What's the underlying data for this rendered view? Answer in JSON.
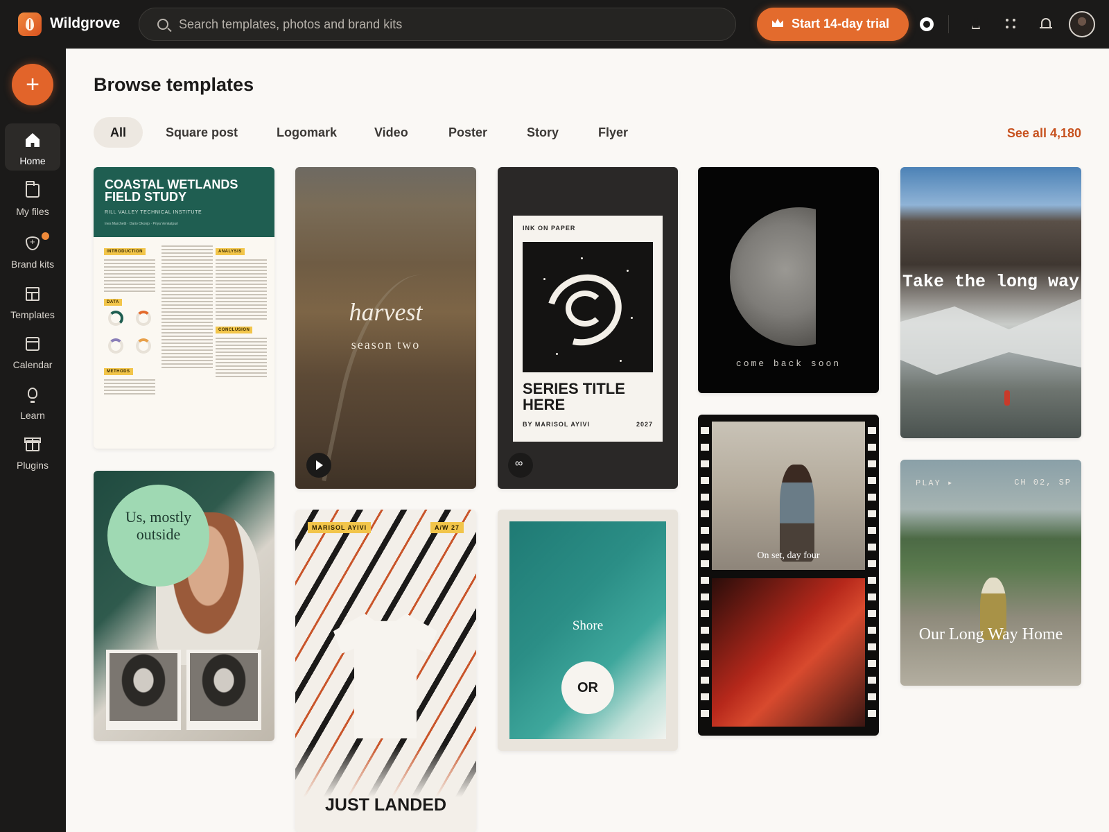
{
  "app": {
    "name": "Wildgrove",
    "search_placeholder": "Search templates, photos and brand kits",
    "trial_label": "Start 14-day trial"
  },
  "sidebar": {
    "create_label": "+",
    "items": [
      {
        "label": "Home",
        "icon": "home-icon",
        "active": true
      },
      {
        "label": "My files",
        "icon": "folder-icon"
      },
      {
        "label": "Brand kits",
        "icon": "shield-icon"
      },
      {
        "label": "Templates",
        "icon": "templates-icon"
      },
      {
        "label": "Calendar",
        "icon": "calendar-icon"
      },
      {
        "label": "Learn",
        "icon": "lightbulb-icon"
      },
      {
        "label": "Plugins",
        "icon": "gift-icon"
      }
    ]
  },
  "main": {
    "title": "Browse templates",
    "filters": [
      "All",
      "Square post",
      "Logomark",
      "Video",
      "Poster",
      "Story",
      "Flyer"
    ],
    "active_filter": "All",
    "see_all": "See all 4,180"
  },
  "templates": {
    "coastal": {
      "title": "COASTAL WETLANDS FIELD STUDY",
      "institute": "RILL VALLEY TECHNICAL INSTITUTE",
      "authors": "Ines Marchetti · Dario Okonjo · Priya Venkatpuri",
      "sections": [
        "INTRODUCTION",
        "ANALYSIS",
        "DATA",
        "CONCLUSION",
        "METHODS"
      ]
    },
    "harvest": {
      "title": "harvest",
      "subtitle": "season two"
    },
    "ink": {
      "kicker": "INK ON PAPER",
      "title": "SERIES TITLE HERE",
      "byline": "BY MARISOL AYIVI",
      "year": "2027"
    },
    "moon": {
      "caption": "come back soon"
    },
    "mountain": {
      "quote": "Take the long way"
    },
    "outside": {
      "title": "Us, mostly outside"
    },
    "landed": {
      "brand": "MARISOL AYIVI",
      "season": "A/W 27",
      "title": "JUST LANDED"
    },
    "shore": {
      "title": "Shore",
      "badge": "OR"
    },
    "film": {
      "caption": "On set, day four"
    },
    "longway": {
      "top_left": "PLAY ▸",
      "top_right": "CH 02, SP",
      "title": "Our Long Way Home"
    }
  },
  "colors": {
    "accent": "#e36b2d",
    "link": "#c7521f",
    "sidebar_bg": "#1b1a19"
  }
}
